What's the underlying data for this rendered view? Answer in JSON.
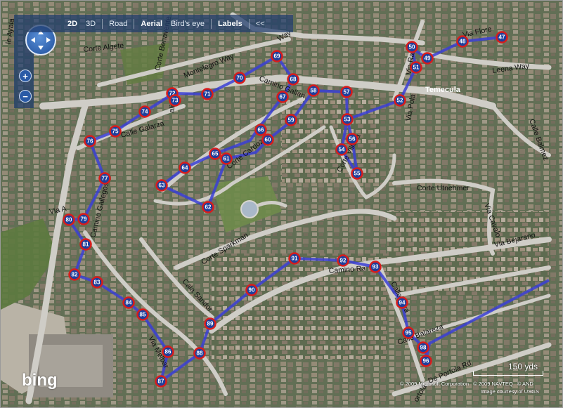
{
  "map": {
    "type": "aerial-with-route",
    "colors": {
      "route": "#3b3fd6",
      "marker_fill": "#1d3f9c",
      "marker_ring": "#d81c1c",
      "street": "#cfcdc7",
      "terrain": "#5a6b48",
      "toolbar": "#1e3c6e"
    }
  },
  "toolbar": {
    "btn_2d": "2D",
    "btn_3d": "3D",
    "btn_road": "Road",
    "btn_aerial": "Aerial",
    "btn_birdseye": "Bird's eye",
    "btn_labels": "Labels",
    "btn_collapse": "<<"
  },
  "nav": {
    "compass_icon": "compass-pan-icon",
    "zoom_in": "+",
    "zoom_out": "−"
  },
  "labels": {
    "corte_algete": "Corte Algete",
    "montelegro_way": "Montelegro Way",
    "corte_benavente": "Corte Benavente",
    "calle_galarza": "Calle Galarza",
    "camino_gallari": "Camino Gallari",
    "corte_cardoza": "Corte Cardoza",
    "corte_villena": "Corte Villena",
    "via_flore": "Via Flore",
    "leena_way": "Leena Way",
    "via_raz": "Via Raz",
    "via_pola": "Via Pola",
    "temecula": "Temecula",
    "calle_balmez": "Calle Balmez",
    "corte_utnehmer": "Corte Utnehmer",
    "via_cavalo": "Via Cavalo",
    "via_bejarano": "Via Bejarano",
    "camino_gallegos": "Camino Gallegos",
    "via_a": "Via A",
    "corte_sparkman": "Corte Sparkman",
    "camino_ra": "Camino Ra",
    "calle_riva": "Calle Riva",
    "cala_sandor": "Cala Sandor",
    "via_melbar": "Via Melbar",
    "calle_balareza": "Calle Balareza",
    "de_portola_rd": "De Portola Rd",
    "portola": "ortola",
    "ayala": "le Ayala",
    "way": "Way",
    "alis": "alis"
  },
  "route_markers": [
    "47",
    "48",
    "49",
    "50",
    "51",
    "52",
    "53",
    "54",
    "55",
    "56",
    "57",
    "58",
    "59",
    "60",
    "61",
    "62",
    "63",
    "64",
    "65",
    "66",
    "67",
    "68",
    "69",
    "70",
    "71",
    "72",
    "73",
    "74",
    "75",
    "76",
    "77",
    "79",
    "80",
    "81",
    "82",
    "83",
    "84",
    "85",
    "86",
    "87",
    "88",
    "89",
    "90",
    "91",
    "92",
    "93",
    "94",
    "95",
    "96",
    "98"
  ],
  "bottom": {
    "logo": "bing",
    "scale": "150 yds",
    "copyright_a": "© 2009 Microsoft Corporation",
    "copyright_b": "© 2009 NAVTEQ",
    "copyright_c": "© AND",
    "credit": "Image courtesy of USGS"
  }
}
